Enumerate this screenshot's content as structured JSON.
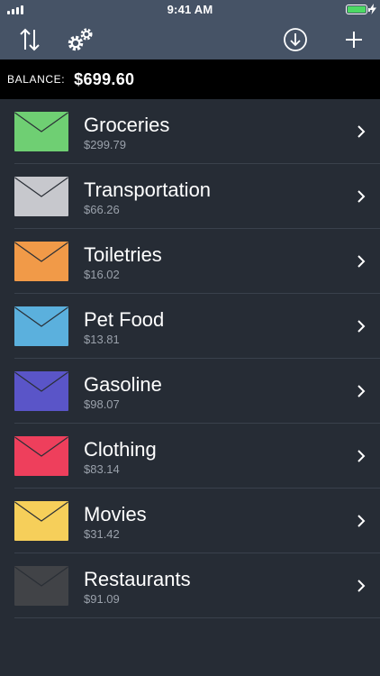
{
  "status_bar": {
    "time": "9:41 AM",
    "battery_color": "#4cd964"
  },
  "nav": {
    "icons": [
      "sort-icon",
      "gear-icon",
      "download-icon",
      "plus-icon"
    ]
  },
  "balance": {
    "label": "BALANCE:",
    "value": "$699.60"
  },
  "envelopes": [
    {
      "name": "Groceries",
      "amount": "$299.79",
      "color": "#6fcf73"
    },
    {
      "name": "Transportation",
      "amount": "$66.26",
      "color": "#c7c8cd"
    },
    {
      "name": "Toiletries",
      "amount": "$16.02",
      "color": "#f19a48"
    },
    {
      "name": "Pet Food",
      "amount": "$13.81",
      "color": "#5bb0dd"
    },
    {
      "name": "Gasoline",
      "amount": "$98.07",
      "color": "#5a55c8"
    },
    {
      "name": "Clothing",
      "amount": "$83.14",
      "color": "#ee3f5c"
    },
    {
      "name": "Movies",
      "amount": "$31.42",
      "color": "#f6cf5a"
    },
    {
      "name": "Restaurants",
      "amount": "$91.09",
      "color": "#414347"
    }
  ]
}
